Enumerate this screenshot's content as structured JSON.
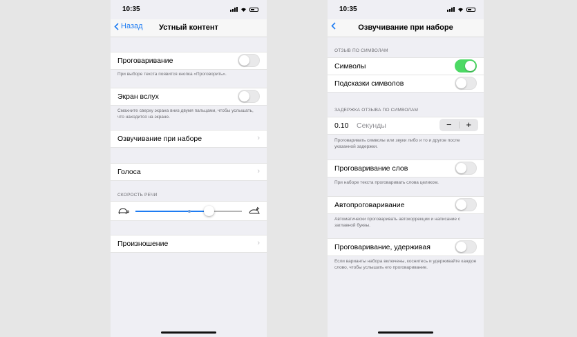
{
  "left": {
    "time": "10:35",
    "back_label": "Назад",
    "title": "Устный контент",
    "speak_selection": {
      "label": "Проговаривание",
      "footer": "При выборе текста появится кнопка «Проговорить».",
      "on": false
    },
    "speak_screen": {
      "label": "Экран вслух",
      "footer": "Смахните сверху экрана вниз двумя пальцами, чтобы услышать, что находится на экране.",
      "on": false
    },
    "typing_feedback": "Озвучивание при наборе",
    "voices": "Голоса",
    "rate_header": "Скорость речи",
    "rate_value": 0.7,
    "pronunciations": "Произношение"
  },
  "right": {
    "time": "10:35",
    "title": "Озвучивание при наборе",
    "char_header": "Отзыв по символам",
    "characters": {
      "label": "Символы",
      "on": true
    },
    "char_hints": {
      "label": "Подсказки символов",
      "on": false
    },
    "delay_header": "Задержка отзыва по символам",
    "delay_value": "0.10",
    "delay_unit": "Секунды",
    "stepper_minus": "−",
    "stepper_plus": "+",
    "delay_footer": "Проговаривать символы или звуки либо и то и другое после указанной задержки.",
    "speak_words": {
      "label": "Проговаривание слов",
      "footer": "При наборе текста проговаривать слова целиком.",
      "on": false
    },
    "auto_text": {
      "label": "Автопроговаривание",
      "footer": "Автоматически проговаривать автокоррекции и написание с заглавной буквы.",
      "on": false
    },
    "hold_to_speak": {
      "label": "Проговаривание, удерживая",
      "footer": "Если варианты набора включены, коснитесь и удерживайте каждое слово, чтобы услышать его проговаривание.",
      "on": false
    }
  },
  "colors": {
    "accent": "#1e7cf2",
    "toggle_on": "#4cd964"
  }
}
